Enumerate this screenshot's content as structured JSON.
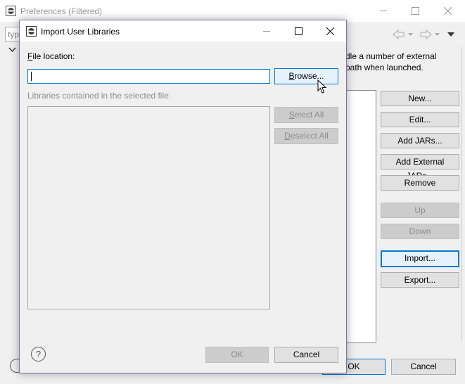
{
  "bg_window": {
    "title": "Preferences (Filtered)",
    "filter_placeholder_fragment": "typ",
    "description_line1": "dle a number of external",
    "description_line2": "path when launched.",
    "buttons": {
      "new": "New...",
      "edit": "Edit...",
      "add_jars": "Add JARs...",
      "add_external_jars": "Add External JARs...",
      "remove": "Remove",
      "up": "Up",
      "down": "Down",
      "import": "Import...",
      "export": "Export..."
    },
    "ok": "OK",
    "cancel": "Cancel"
  },
  "dialog": {
    "title": "Import User Libraries",
    "file_location_label": "File location:",
    "file_location_value": "",
    "browse_button": "Browse...",
    "libraries_label": "Libraries contained in the selected file:",
    "select_all_button": "Select All",
    "deselect_all_button": "Deselect All",
    "ok_button": "OK",
    "cancel_button": "Cancel"
  },
  "colors": {
    "accent": "#0078d7",
    "dialog_border": "#7a6fa8"
  }
}
